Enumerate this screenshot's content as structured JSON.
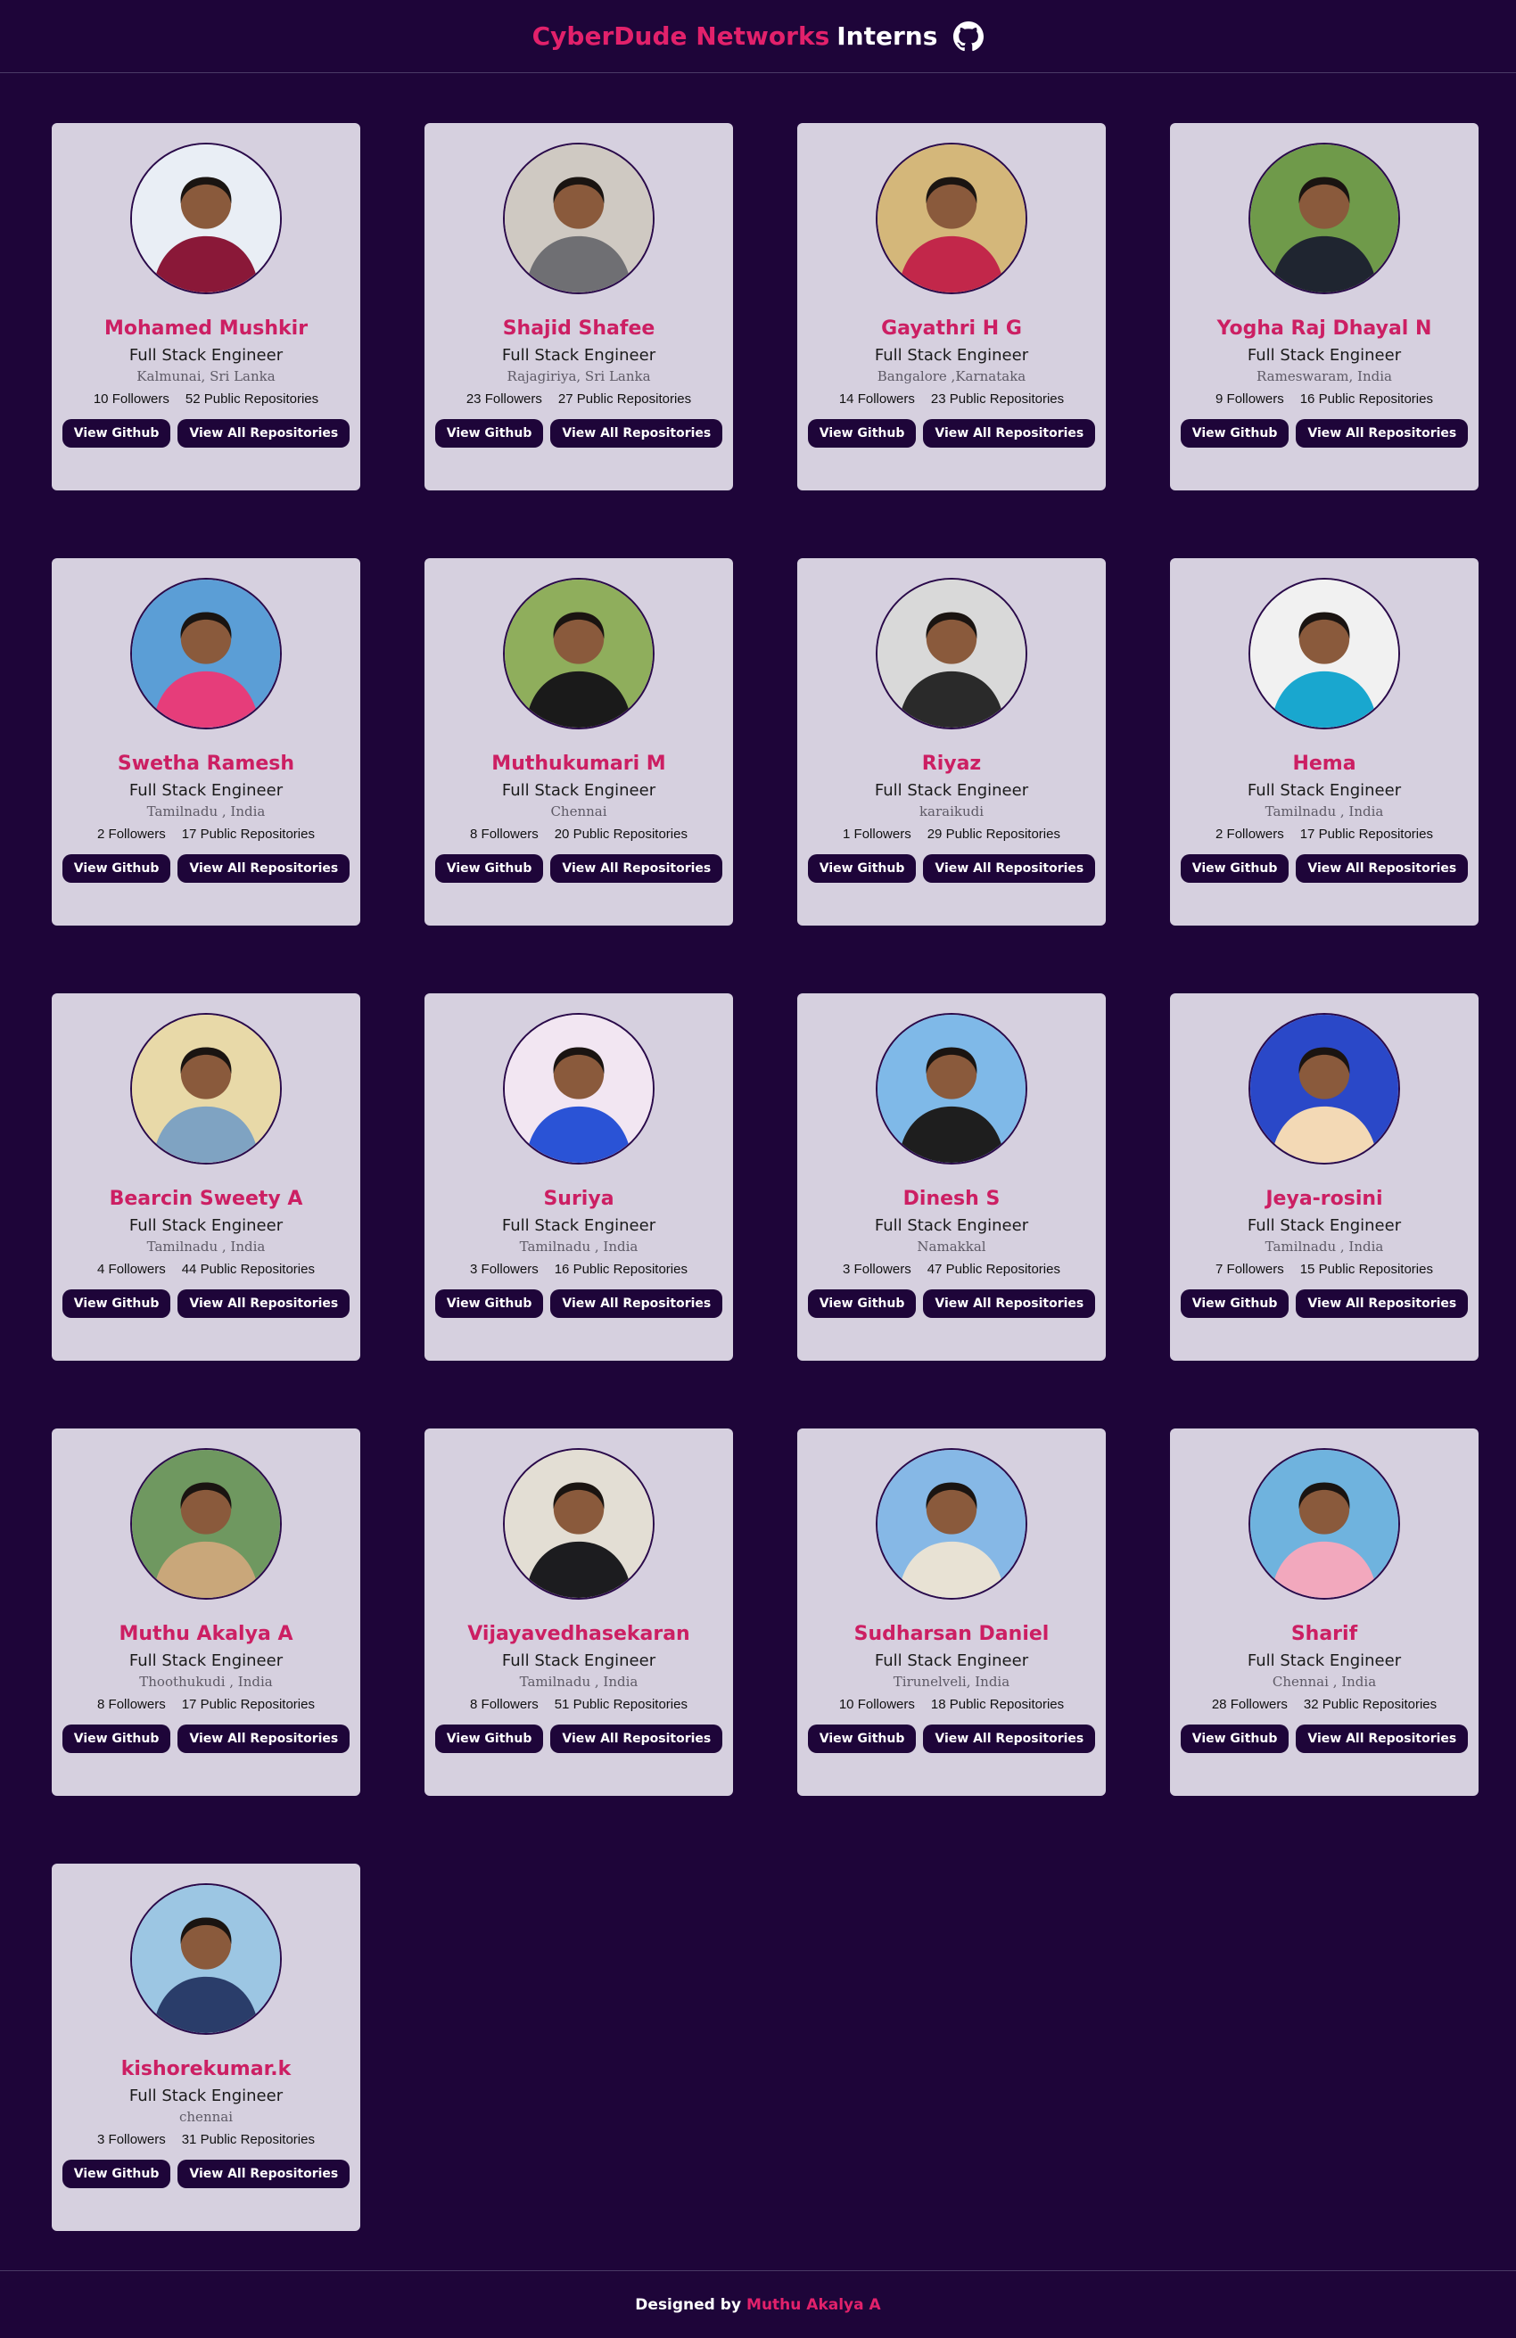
{
  "header": {
    "brand": "CyberDude Networks",
    "suffix": "Interns",
    "icon": "github-icon"
  },
  "interns": [
    {
      "name": "Mohamed Mushkir",
      "role": "Full Stack Engineer",
      "location": "Kalmunai, Sri Lanka",
      "followers": "10 Followers",
      "repos": "52 Public Repositories",
      "github_label": "View Github",
      "repos_label": "View All Repositories",
      "avatar_bg": "#e9eef5",
      "avatar_fg": "#8a1838"
    },
    {
      "name": "Shajid Shafee",
      "role": "Full Stack Engineer",
      "location": "Rajagiriya, Sri Lanka",
      "followers": "23 Followers",
      "repos": "27 Public Repositories",
      "github_label": "View Github",
      "repos_label": "View All Repositories",
      "avatar_bg": "#cfc9c2",
      "avatar_fg": "#6f6f73"
    },
    {
      "name": "Gayathri H G",
      "role": "Full Stack Engineer",
      "location": "Bangalore ,Karnataka",
      "followers": "14 Followers",
      "repos": "23 Public Repositories",
      "github_label": "View Github",
      "repos_label": "View All Repositories",
      "avatar_bg": "#d4b77a",
      "avatar_fg": "#c2274a"
    },
    {
      "name": "Yogha Raj Dhayal N",
      "role": "Full Stack Engineer",
      "location": "Rameswaram, India",
      "followers": "9 Followers",
      "repos": "16 Public Repositories",
      "github_label": "View Github",
      "repos_label": "View All Repositories",
      "avatar_bg": "#6f9a4a",
      "avatar_fg": "#1f2530"
    },
    {
      "name": "Swetha Ramesh",
      "role": "Full Stack Engineer",
      "location": "Tamilnadu , India",
      "followers": "2 Followers",
      "repos": "17 Public Repositories",
      "github_label": "View Github",
      "repos_label": "View All Repositories",
      "avatar_bg": "#5b9ed6",
      "avatar_fg": "#e63d7a"
    },
    {
      "name": "Muthukumari M",
      "role": "Full Stack Engineer",
      "location": "Chennai",
      "followers": "8 Followers",
      "repos": "20 Public Repositories",
      "github_label": "View Github",
      "repos_label": "View All Repositories",
      "avatar_bg": "#8fae5c",
      "avatar_fg": "#1a1a1a"
    },
    {
      "name": "Riyaz",
      "role": "Full Stack Engineer",
      "location": "karaikudi",
      "followers": "1 Followers",
      "repos": "29 Public Repositories",
      "github_label": "View Github",
      "repos_label": "View All Repositories",
      "avatar_bg": "#d9d9d9",
      "avatar_fg": "#2a2a2a"
    },
    {
      "name": "Hema",
      "role": "Full Stack Engineer",
      "location": "Tamilnadu , India",
      "followers": "2 Followers",
      "repos": "17 Public Repositories",
      "github_label": "View Github",
      "repos_label": "View All Repositories",
      "avatar_bg": "#f1f1f1",
      "avatar_fg": "#19a7cf"
    },
    {
      "name": "Bearcin Sweety A",
      "role": "Full Stack Engineer",
      "location": "Tamilnadu , India",
      "followers": "4 Followers",
      "repos": "44 Public Repositories",
      "github_label": "View Github",
      "repos_label": "View All Repositories",
      "avatar_bg": "#e8d9a8",
      "avatar_fg": "#7fa3c2"
    },
    {
      "name": "Suriya",
      "role": "Full Stack Engineer",
      "location": "Tamilnadu , India",
      "followers": "3 Followers",
      "repos": "16 Public Repositories",
      "github_label": "View Github",
      "repos_label": "View All Repositories",
      "avatar_bg": "#f2e6f2",
      "avatar_fg": "#2a53d6"
    },
    {
      "name": "Dinesh S",
      "role": "Full Stack Engineer",
      "location": "Namakkal",
      "followers": "3 Followers",
      "repos": "47 Public Repositories",
      "github_label": "View Github",
      "repos_label": "View All Repositories",
      "avatar_bg": "#7fb9e8",
      "avatar_fg": "#1e1e1e"
    },
    {
      "name": "Jeya-rosini",
      "role": "Full Stack Engineer",
      "location": "Tamilnadu , India",
      "followers": "7 Followers",
      "repos": "15 Public Repositories",
      "github_label": "View Github",
      "repos_label": "View All Repositories",
      "avatar_bg": "#2a48c8",
      "avatar_fg": "#f3d9b5"
    },
    {
      "name": "Muthu Akalya A",
      "role": "Full Stack Engineer",
      "location": "Thoothukudi , India",
      "followers": "8 Followers",
      "repos": "17 Public Repositories",
      "github_label": "View Github",
      "repos_label": "View All Repositories",
      "avatar_bg": "#6f9860",
      "avatar_fg": "#c9a77a"
    },
    {
      "name": "Vijayavedhasekaran",
      "role": "Full Stack Engineer",
      "location": "Tamilnadu , India",
      "followers": "8 Followers",
      "repos": "51 Public Repositories",
      "github_label": "View Github",
      "repos_label": "View All Repositories",
      "avatar_bg": "#e3ded4",
      "avatar_fg": "#1c1c1f"
    },
    {
      "name": "Sudharsan Daniel",
      "role": "Full Stack Engineer",
      "location": "Tirunelveli, India",
      "followers": "10 Followers",
      "repos": "18 Public Repositories",
      "github_label": "View Github",
      "repos_label": "View All Repositories",
      "avatar_bg": "#86b8e6",
      "avatar_fg": "#e8e2d4"
    },
    {
      "name": "Sharif",
      "role": "Full Stack Engineer",
      "location": "Chennai , India",
      "followers": "28 Followers",
      "repos": "32 Public Repositories",
      "github_label": "View Github",
      "repos_label": "View All Repositories",
      "avatar_bg": "#6fb3de",
      "avatar_fg": "#f2a8bd"
    },
    {
      "name": "kishorekumar.k",
      "role": "Full Stack Engineer",
      "location": "chennai",
      "followers": "3 Followers",
      "repos": "31 Public Repositories",
      "github_label": "View Github",
      "repos_label": "View All Repositories",
      "avatar_bg": "#9cc6e3",
      "avatar_fg": "#2a3d6a"
    }
  ],
  "footer": {
    "prefix": "Designed by",
    "author": "Muthu Akalya A"
  }
}
